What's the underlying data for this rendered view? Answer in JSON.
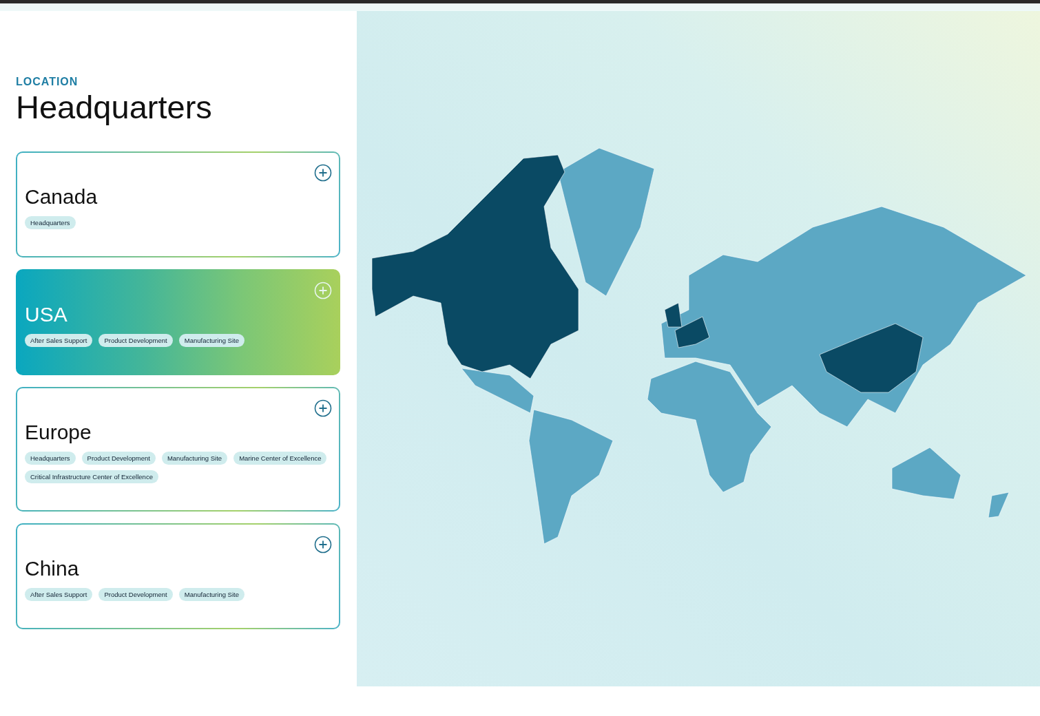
{
  "header": {
    "eyebrow": "LOCATION",
    "title": "Headquarters"
  },
  "locations": [
    {
      "name": "Canada",
      "selected": false,
      "tags": [
        "Headquarters"
      ]
    },
    {
      "name": "USA",
      "selected": true,
      "tags": [
        "After Sales Support",
        "Product Development",
        "Manufacturing Site"
      ]
    },
    {
      "name": "Europe",
      "selected": false,
      "tags": [
        "Headquarters",
        "Product Development",
        "Manufacturing Site",
        "Marine Center of Excellence",
        "Critical Infrastructure Center of Excellence"
      ]
    },
    {
      "name": "China",
      "selected": false,
      "tags": [
        "After Sales Support",
        "Product Development",
        "Manufacturing Site"
      ]
    }
  ]
}
